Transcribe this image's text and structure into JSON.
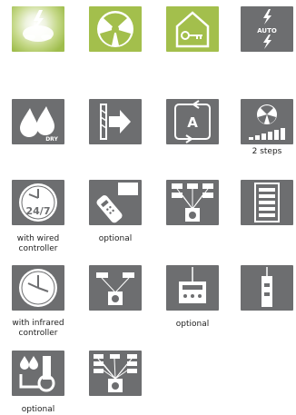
{
  "colors": {
    "green": "#8fae3b",
    "green_light": "#a3bf4c",
    "grey": "#6d6e70",
    "icon_white": "#ffffff"
  },
  "rows": [
    {
      "tiles": [
        {
          "icon": "heating-icon",
          "caption": ""
        },
        {
          "icon": "fan-icon",
          "caption": ""
        },
        {
          "icon": "house-key-icon",
          "caption": ""
        },
        {
          "icon": "auto-mode-icon",
          "caption": ""
        }
      ]
    },
    {
      "tiles": [
        {
          "icon": "dry-mode-icon",
          "caption": ""
        },
        {
          "icon": "air-direction-icon",
          "caption": ""
        },
        {
          "icon": "auto-restart-icon",
          "caption": ""
        },
        {
          "icon": "fan-speed-icon",
          "caption": "2 steps"
        }
      ]
    },
    {
      "tiles": [
        {
          "icon": "timer-24-7-icon",
          "caption_line1": "with wired",
          "caption_line2": "controller"
        },
        {
          "icon": "remote-controller-icon",
          "caption": "optional"
        },
        {
          "icon": "central-control-icon",
          "caption": ""
        },
        {
          "icon": "list-panel-icon",
          "caption": ""
        }
      ]
    },
    {
      "tiles": [
        {
          "icon": "clock-icon",
          "caption_line1": "with infrared",
          "caption_line2": "controller"
        },
        {
          "icon": "group-control-icon",
          "caption": ""
        },
        {
          "icon": "interface-box-icon",
          "caption": "optional"
        },
        {
          "icon": "wall-switch-icon",
          "caption": ""
        }
      ]
    },
    {
      "tiles": [
        {
          "icon": "condensate-pump-icon",
          "caption": "optional"
        },
        {
          "icon": "network-control-icon",
          "caption": ""
        }
      ]
    }
  ],
  "icon_text": {
    "auto": "AUTO",
    "dry": "DRY",
    "a": "A",
    "timer": "24/7"
  }
}
